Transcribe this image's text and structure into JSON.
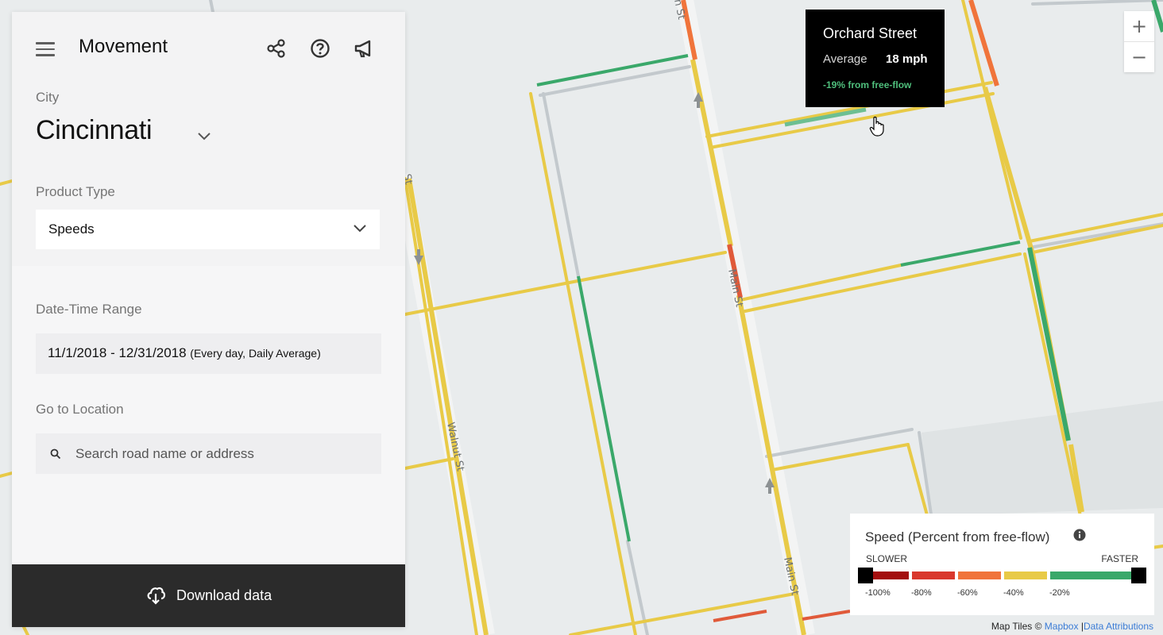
{
  "app": {
    "title": "Movement"
  },
  "header_icons": [
    "share-icon",
    "help-icon",
    "megaphone-icon"
  ],
  "filters": {
    "city_label": "City",
    "city_value": "Cincinnati",
    "product_type_label": "Product Type",
    "product_type_value": "Speeds",
    "date_range_label": "Date-Time Range",
    "date_range_value": "11/1/2018 - 12/31/2018",
    "date_range_note": "(Every day, Daily Average)",
    "location_label": "Go to Location",
    "search_placeholder": "Search road name or address",
    "search_value": ""
  },
  "download": {
    "label": "Download data"
  },
  "tooltip": {
    "street": "Orchard Street",
    "average_label": "Average",
    "average_value": "18 mph",
    "delta": "-19% from free-flow"
  },
  "zoom": {
    "in": "+",
    "out": "−"
  },
  "legend": {
    "title": "Speed (Percent from free-flow)",
    "slower": "SLOWER",
    "faster": "FASTER",
    "ticks": [
      "-100%",
      "-80%",
      "-60%",
      "-40%",
      "-20%"
    ],
    "colors": [
      "#a30f0f",
      "#d9382d",
      "#f0743b",
      "#e8ca47",
      "#3aa86a"
    ]
  },
  "attribution": {
    "prefix": "Map Tiles © ",
    "mapbox": "Mapbox",
    "separator": " |",
    "data": "Data Attributions"
  },
  "map": {
    "street_labels": [
      "Main St",
      "Walnut St",
      "Main St",
      "n St",
      "St"
    ],
    "speed_colors": {
      "green": "#3aa86a",
      "yellow": "#e8ca47",
      "orange": "#f0743b",
      "red": "#e05a3a",
      "gray": "#c3c9cd"
    }
  }
}
